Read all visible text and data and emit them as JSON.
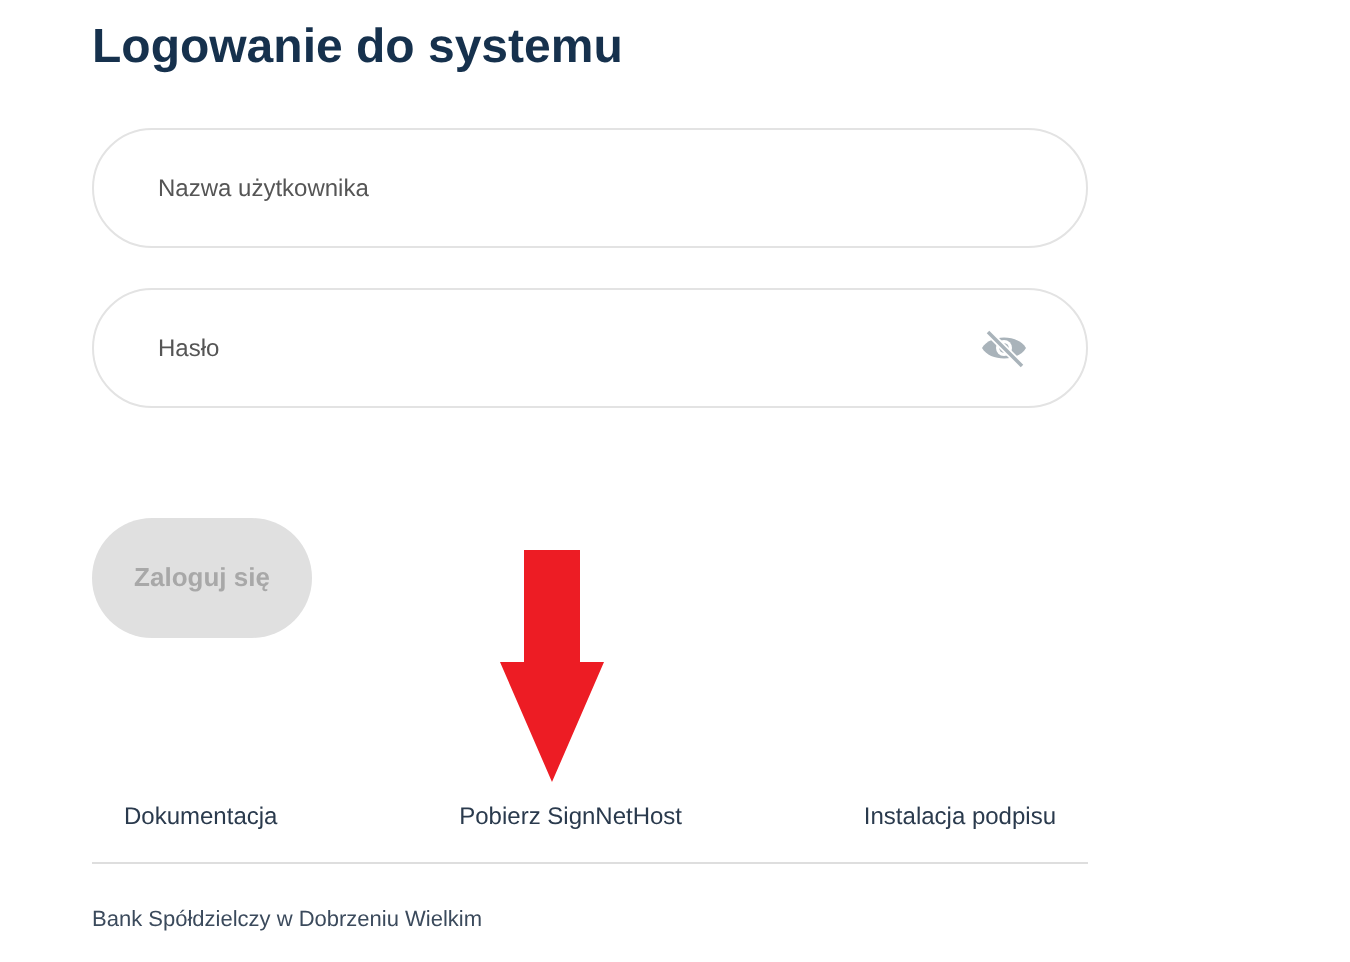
{
  "title": "Logowanie do systemu",
  "fields": [
    {
      "placeholder": "Nazwa użytkownika",
      "kind": "text"
    },
    {
      "placeholder": "Hasło",
      "kind": "password"
    }
  ],
  "login_button": {
    "label": "Zaloguj się",
    "disabled": true
  },
  "links": [
    {
      "label": "Dokumentacja"
    },
    {
      "label": "Pobierz SignNetHost"
    },
    {
      "label": "Instalacja podpisu"
    }
  ],
  "footer": "Bank Spółdzielczy w Dobrzeniu Wielkim"
}
